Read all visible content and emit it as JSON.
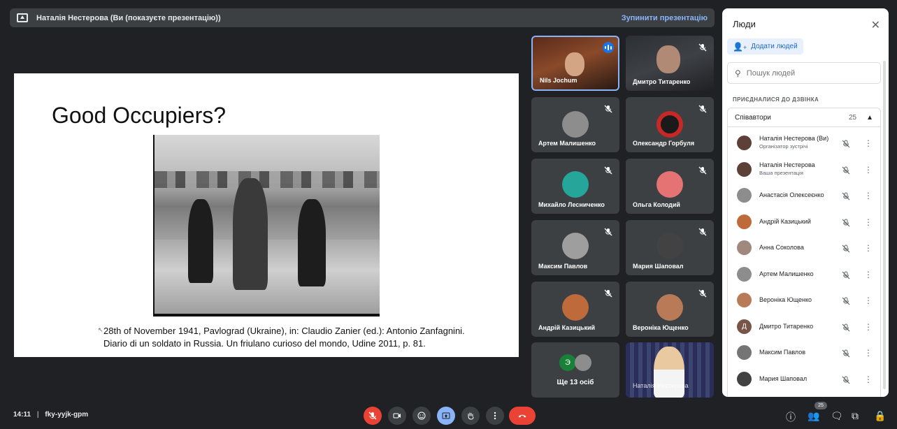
{
  "banner": {
    "presenter_text": "Наталія Нестерова (Ви (показуєте презентацію))",
    "stop_label": "Зупинити презентацію"
  },
  "slide": {
    "title": "Good Occupiers?",
    "caption_line1": "28th of November 1941, Pavlograd (Ukraine), in: Claudio Zanier (ed.): Antonio Zanfagnini.",
    "caption_line2": "Diario di un soldato in Russia. Un friulano curioso del mondo, Udine 2011, p. 81."
  },
  "tiles": [
    {
      "name": "Nils Jochum",
      "type": "video",
      "speaking": true
    },
    {
      "name": "Дмитро Титаренко",
      "type": "video",
      "muted": true
    },
    {
      "name": "Артем Малишенко",
      "muted": true,
      "avatar_color": "#8d8d8d"
    },
    {
      "name": "Олександр Горбуля",
      "muted": true,
      "avatar_color": "#c62828"
    },
    {
      "name": "Михайло Лесниченко",
      "muted": true,
      "avatar_color": "#26a69a"
    },
    {
      "name": "Ольга Колодий",
      "muted": true,
      "avatar_color": "#e57373"
    },
    {
      "name": "Максим Павлов",
      "muted": true,
      "avatar_color": "#9e9e9e"
    },
    {
      "name": "Мария Шаповал",
      "muted": true,
      "avatar_color": "#424242"
    },
    {
      "name": "Андрій Казицький",
      "muted": true,
      "avatar_color": "#bf6a3a"
    },
    {
      "name": "Вероніка Ющенко",
      "muted": true,
      "avatar_color": "#b97a57"
    }
  ],
  "more_tile": {
    "initial": "Э",
    "label": "Ще 13 осіб"
  },
  "self_tile": {
    "name": "Наталія Нестерова"
  },
  "panel": {
    "title": "Люди",
    "add_label": "Додати людей",
    "search_placeholder": "Пошук людей",
    "section_label": "ПРИЄДНАЛИСЯ ДО ДЗВІНКА",
    "group_label": "Співавтори",
    "group_count": "25",
    "people": [
      {
        "name": "Наталія Нестерова (Ви)",
        "sub": "Організатор зустрічі",
        "avatar_color": "#5d4037",
        "initial": ""
      },
      {
        "name": "Наталія Нестерова",
        "sub": "Ваша презентація",
        "avatar_color": "#5d4037",
        "initial": ""
      },
      {
        "name": "Анастасія Олексеєнко",
        "sub": "",
        "avatar_color": "#8d8d8d",
        "initial": ""
      },
      {
        "name": "Андрій Казицький",
        "sub": "",
        "avatar_color": "#bf6a3a",
        "initial": ""
      },
      {
        "name": "Анна Соколова",
        "sub": "",
        "avatar_color": "#a1887f",
        "initial": ""
      },
      {
        "name": "Артем Малишенко",
        "sub": "",
        "avatar_color": "#8d8d8d",
        "initial": ""
      },
      {
        "name": "Вероніка Ющенко",
        "sub": "",
        "avatar_color": "#b97a57",
        "initial": ""
      },
      {
        "name": "Дмитро Титаренко",
        "sub": "",
        "avatar_color": "#795548",
        "initial": "Д"
      },
      {
        "name": "Максим Павлов",
        "sub": "",
        "avatar_color": "#757575",
        "initial": ""
      },
      {
        "name": "Мария Шаповал",
        "sub": "",
        "avatar_color": "#424242",
        "initial": ""
      }
    ]
  },
  "bottom": {
    "time": "14:11",
    "meeting_code": "fky-yyjk-gpm",
    "people_badge": "25"
  },
  "colors": {
    "end_call": "#ea4335",
    "active_present": "#8ab4f8",
    "mute_red": "#ea4335"
  }
}
